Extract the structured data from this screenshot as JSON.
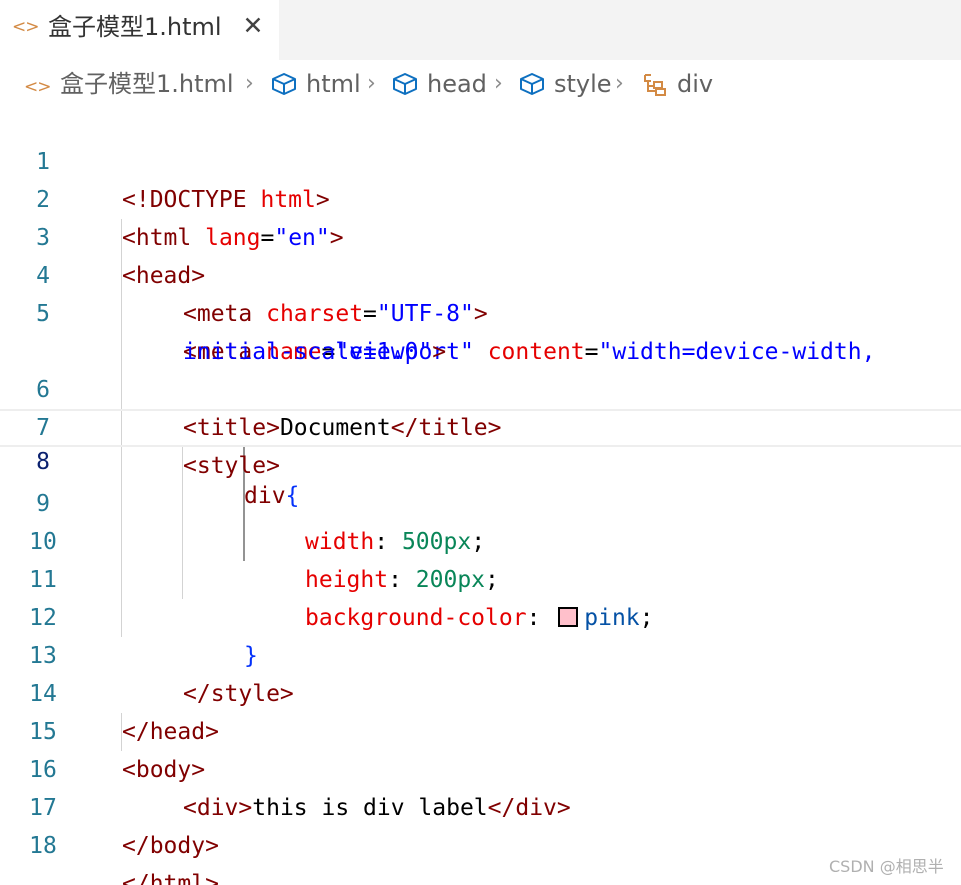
{
  "tab": {
    "icon": "code-brackets-icon",
    "title": "盒子模型1.html",
    "close_glyph": "✕"
  },
  "breadcrumb": {
    "file": "盒子模型1.html",
    "items": [
      "html",
      "head",
      "style",
      "div"
    ],
    "separator": "›"
  },
  "editor": {
    "current_line": 8,
    "lines": [
      "<!DOCTYPE html>",
      "<html lang=\"en\">",
      "<head>",
      "    <meta charset=\"UTF-8\">",
      "    <meta name=\"viewport\" content=\"width=device-width, initial-scale=1.0\">",
      "    <title>Document</title>",
      "    <style>",
      "        div{",
      "            width: 500px;",
      "            height: 200px;",
      "            background-color: pink;",
      "        }",
      "    </style>",
      "</head>",
      "<body>",
      "    <div>this is div label</div>",
      "</body>",
      "</html>"
    ],
    "line_numbers": [
      "1",
      "2",
      "3",
      "4",
      "5",
      "6",
      "7",
      "8",
      "9",
      "10",
      "11",
      "12",
      "13",
      "14",
      "15",
      "16",
      "17",
      "18"
    ],
    "tokens": {
      "l1_open": "<!DOCTYPE",
      "l1_html": "html",
      "l1_close": ">",
      "l2_open": "<html",
      "l2_attr": "lang",
      "l2_eq": "=",
      "l2_val": "\"en\"",
      "l2_close": ">",
      "l3_tag": "<head>",
      "l4_open": "<meta",
      "l4_attr": "charset",
      "l4_eq": "=",
      "l4_val": "\"UTF-8\"",
      "l4_close": ">",
      "l5_open": "<meta",
      "l5_attr1": "name",
      "l5_eq1": "=",
      "l5_val1": "\"viewport\"",
      "l5_attr2": "content",
      "l5_eq2": "=",
      "l5_val2a": "\"width=device-width,",
      "l5_val2b": "initial-scale=1.0\"",
      "l5_close": ">",
      "l6_open": "<title>",
      "l6_text": "Document",
      "l6_close": "</title>",
      "l7_tag": "<style>",
      "l8_sel": "div",
      "l8_brace": "{",
      "l9_prop": "width",
      "l9_colon": ": ",
      "l9_val": "500px",
      "l9_semi": ";",
      "l10_prop": "height",
      "l10_colon": ": ",
      "l10_val": "200px",
      "l10_semi": ";",
      "l11_prop": "background-color",
      "l11_colon": ": ",
      "l11_val": "pink",
      "l11_semi": ";",
      "l12_brace": "}",
      "l13_tag": "</style>",
      "l14_tag": "</head>",
      "l15_tag": "<body>",
      "l16_open": "<div>",
      "l16_text": "this is div label",
      "l16_close": "</div>",
      "l17_tag": "</body>",
      "l18_tag": "</html>"
    }
  },
  "colors": {
    "tag": "#800000",
    "attribute": "#e50000",
    "string": "#0000ff",
    "number": "#098658",
    "keyword_value": "#0451a5",
    "brace": "#0431fa",
    "line_number": "#237893",
    "file_icon": "#d38a44",
    "swatch_pink": "#ffc0cb"
  },
  "watermark": "CSDN @相思半"
}
